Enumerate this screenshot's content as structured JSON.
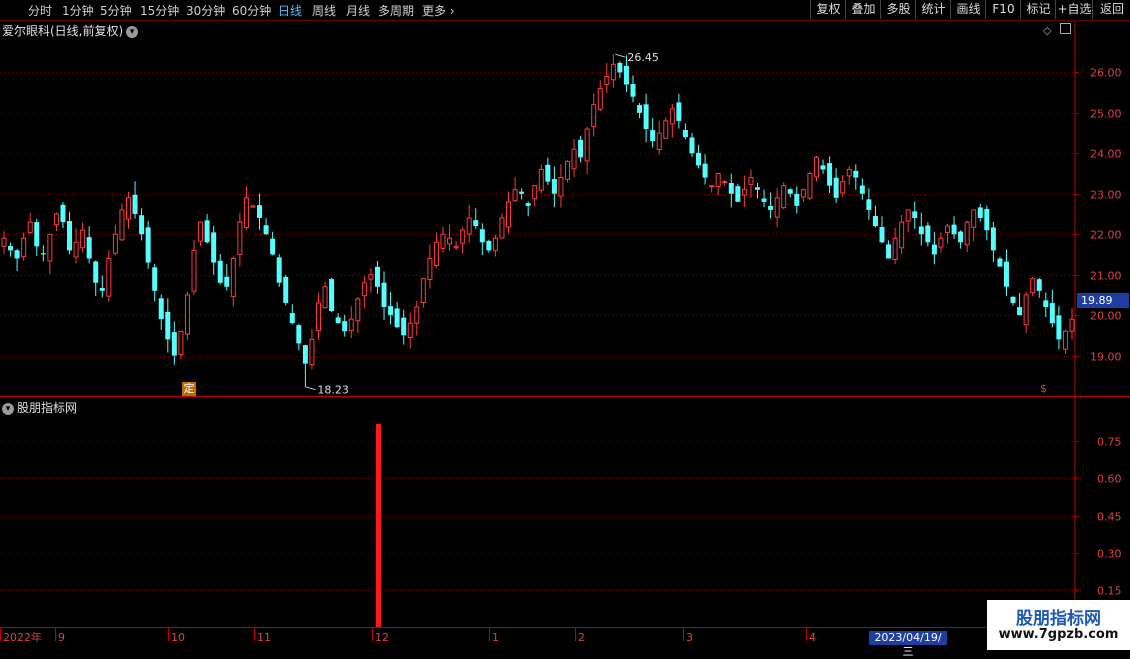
{
  "toolbar": {
    "periods": [
      {
        "label": "分时",
        "active": false
      },
      {
        "label": "1分钟",
        "active": false
      },
      {
        "label": "5分钟",
        "active": false
      },
      {
        "label": "15分钟",
        "active": false
      },
      {
        "label": "30分钟",
        "active": false
      },
      {
        "label": "60分钟",
        "active": false
      },
      {
        "label": "日线",
        "active": true
      },
      {
        "label": "周线",
        "active": false
      },
      {
        "label": "月线",
        "active": false
      },
      {
        "label": "多周期",
        "active": false
      },
      {
        "label": "更多",
        "active": false
      }
    ],
    "more_icon": "chevron-right-icon",
    "right_buttons": [
      "复权",
      "叠加",
      "多股",
      "统计",
      "画线",
      "F10",
      "标记",
      "+自选",
      "返回"
    ]
  },
  "main_panel": {
    "title": "爱尔眼科(日线,前复权)",
    "dropdown_icon": "chevron-down-icon",
    "diamond_icon": "diamond-icon",
    "toggle_icon": "panel-toggle-icon",
    "high_label": "26.45",
    "low_label": "18.23",
    "current_price": "19.89",
    "ding_badge": "定",
    "dollar_mark": "$"
  },
  "indicator_panel": {
    "title": "股朋指标网",
    "dropdown_icon": "chevron-down-icon"
  },
  "date_axis": {
    "labels": [
      "2022年",
      "9",
      "10",
      "11",
      "12",
      "1",
      "2",
      "3",
      "4"
    ],
    "cursor_date": "2023/04/19/三"
  },
  "watermark": {
    "name": "股朋指标网",
    "url": "www.7gpzb.com"
  },
  "colors": {
    "up": "#ff3b3b",
    "down": "#54ffff",
    "grid": "#7a0000",
    "axis": "#c00000",
    "indicator_bar": "#ff1a1a",
    "price_tag": "#1e3fa0"
  },
  "chart_data": [
    {
      "type": "candlestick",
      "title": "爱尔眼科(日线,前复权)",
      "y_ticks": [
        "19.00",
        "20.00",
        "21.00",
        "22.00",
        "23.00",
        "24.00",
        "25.00",
        "26.00"
      ],
      "ylim": [
        18.0,
        26.9
      ],
      "grid": true,
      "x_months": [
        "2022年",
        "9",
        "10",
        "11",
        "12",
        "1",
        "2",
        "3",
        "4"
      ],
      "close_series": [
        21.9,
        21.6,
        21.4,
        21.9,
        22.3,
        21.7,
        21.5,
        22.0,
        22.5,
        22.3,
        21.6,
        21.8,
        22.1,
        21.4,
        20.8,
        20.6,
        21.4,
        22.0,
        22.6,
        22.9,
        22.5,
        22.0,
        21.3,
        20.6,
        19.9,
        19.4,
        19.0,
        19.6,
        20.5,
        21.6,
        22.3,
        21.8,
        21.3,
        20.8,
        20.7,
        21.4,
        22.3,
        22.9,
        22.7,
        22.4,
        22.0,
        21.5,
        20.8,
        20.3,
        19.8,
        19.3,
        18.8,
        19.4,
        20.3,
        20.7,
        20.1,
        19.8,
        19.6,
        19.9,
        20.4,
        20.8,
        21.0,
        20.7,
        20.2,
        20.0,
        19.7,
        19.5,
        19.8,
        20.2,
        20.9,
        21.4,
        21.8,
        22.0,
        21.9,
        21.7,
        22.1,
        22.4,
        22.2,
        21.8,
        21.6,
        21.9,
        22.4,
        22.8,
        23.1,
        23.0,
        22.7,
        23.2,
        23.6,
        23.3,
        23.0,
        23.4,
        23.8,
        24.1,
        23.9,
        24.6,
        25.2,
        25.6,
        25.9,
        26.2,
        26.0,
        25.7,
        25.4,
        25.0,
        24.6,
        24.3,
        24.5,
        24.8,
        25.1,
        24.8,
        24.4,
        24.0,
        23.7,
        23.4,
        23.2,
        23.5,
        23.3,
        23.0,
        22.8,
        23.1,
        23.4,
        23.1,
        22.8,
        22.6,
        22.9,
        23.2,
        23.0,
        22.7,
        23.1,
        23.5,
        23.9,
        23.6,
        23.2,
        22.9,
        23.3,
        23.6,
        23.4,
        23.0,
        22.6,
        22.2,
        21.8,
        21.4,
        21.9,
        22.3,
        22.6,
        22.4,
        22.0,
        21.8,
        21.5,
        21.9,
        22.2,
        22.0,
        21.8,
        22.3,
        22.6,
        22.4,
        22.1,
        21.6,
        21.2,
        20.7,
        20.3,
        20.0,
        20.5,
        20.9,
        20.6,
        20.2,
        19.8,
        19.4,
        19.6,
        19.9
      ]
    },
    {
      "type": "bar",
      "title": "股朋指标网",
      "y_ticks": [
        "0.15",
        "0.30",
        "0.45",
        "0.60",
        "0.75"
      ],
      "ylim": [
        0.0,
        0.86
      ],
      "bars": [
        {
          "x": "12",
          "value": 0.82
        }
      ]
    }
  ]
}
